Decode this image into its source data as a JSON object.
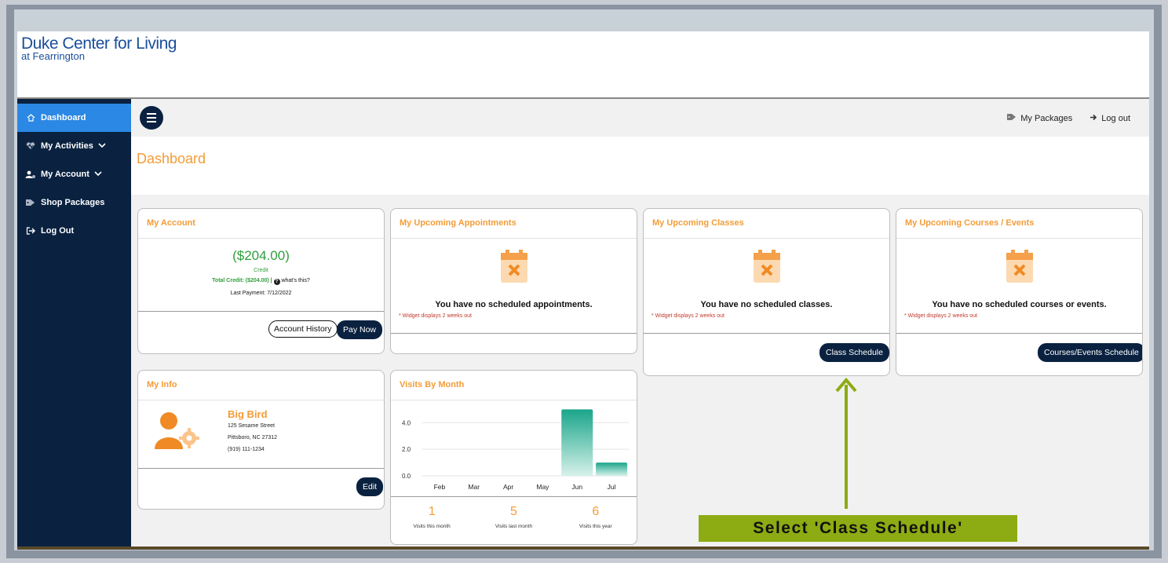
{
  "brand": {
    "name": "Duke Center for Living",
    "sub": "at Fearrington"
  },
  "sidebar": {
    "items": [
      {
        "label": "Dashboard",
        "icon": "home-icon"
      },
      {
        "label": "My Activities",
        "icon": "heart-pulse-icon"
      },
      {
        "label": "My Account",
        "icon": "user-gear-icon"
      },
      {
        "label": "Shop Packages",
        "icon": "tags-icon"
      },
      {
        "label": "Log Out",
        "icon": "sign-out-icon"
      }
    ]
  },
  "topbar": {
    "packages": "My Packages",
    "logout": "Log out"
  },
  "page_title": "Dashboard",
  "account": {
    "title": "My Account",
    "balance": "($204.00)",
    "credit_label": "Credit",
    "total_credit": "Total Credit: ($204.00)",
    "separator": "|",
    "whats_this": "what's this?",
    "last_payment": "Last Payment: 7/12/2022",
    "history_btn": "Account History",
    "pay_btn": "Pay Now"
  },
  "appointments": {
    "title": "My Upcoming Appointments",
    "empty": "You have no scheduled appointments.",
    "note": "* Widget displays 2 weeks out"
  },
  "classes": {
    "title": "My Upcoming Classes",
    "empty": "You have no scheduled classes.",
    "note": "* Widget displays 2 weeks out",
    "button": "Class Schedule"
  },
  "courses": {
    "title": "My Upcoming Courses / Events",
    "empty": "You have no scheduled courses or events.",
    "note": "* Widget displays 2 weeks out",
    "button": "Courses/Events Schedule"
  },
  "info": {
    "title": "My Info",
    "name": "Big Bird",
    "street": "125 Sesame Street",
    "city": "Pittsboro, NC 27312",
    "phone": "(919) 111-1234",
    "edit": "Edit"
  },
  "visits": {
    "title": "Visits By Month",
    "stats": [
      {
        "value": "1",
        "label": "Visits this month"
      },
      {
        "value": "5",
        "label": "Visits last month"
      },
      {
        "value": "6",
        "label": "Visits this year"
      }
    ]
  },
  "chart_data": {
    "type": "bar",
    "categories": [
      "Feb",
      "Mar",
      "Apr",
      "May",
      "Jun",
      "Jul"
    ],
    "values": [
      0,
      0,
      0,
      0,
      5,
      1
    ],
    "yticks": [
      "0.0",
      "2.0",
      "4.0"
    ],
    "ylim": [
      0,
      5.2
    ],
    "grid": true,
    "color": "#1aa58a"
  },
  "callout": "Select 'Class Schedule'",
  "colors": {
    "accent": "#f39c38",
    "navy": "#0a2240",
    "active": "#2b88e4",
    "callout": "#8dab12",
    "arrow": "#8dab12"
  }
}
